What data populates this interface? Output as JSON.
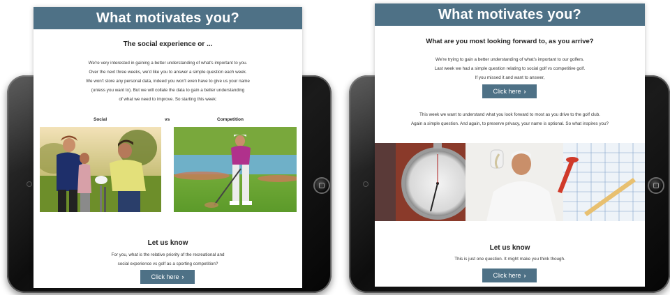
{
  "left_email": {
    "banner": "What motivates you?",
    "heading": "The social experience or ...",
    "intro_lines": [
      "We're very interested in gaining a better understanding of what's important to you.",
      "Over the next three weeks, we'd like you to answer a simple question each week.",
      "We won't store any personal data, indeed you won't even have to give us your name",
      "(unless you want to). But we will collate the data to gain a better understanding",
      "of what we need to improve. So starting this week:"
    ],
    "label_social": "Social",
    "label_vs": "vs",
    "label_competition": "Competition",
    "cta_heading": "Let us know",
    "question_lines": [
      "For you, what is the relative priority of the recreational and",
      "social experience vs golf as a sporting competition?"
    ],
    "button_label": "Click here"
  },
  "right_email": {
    "banner": "What motivates you?",
    "heading": "What are you most looking forward to, as you arrive?",
    "intro_lines": [
      "We're trying to gain a better understanding of what's important to our golfers.",
      "Last week we had a simple question relating to social golf vs competitive golf.",
      "If you missed it and want to answer,"
    ],
    "button_1_label": "Click here",
    "body_lines": [
      "This week we want to understand what you look forward to most as you drive to the golf club.",
      "Again a simple question. And again, to preserve privacy, your name is optional. So what inspires you?"
    ],
    "cta_heading": "Let us know",
    "cta_text": "This is just one question. It might make you think though.",
    "button_2_label": "Click here"
  },
  "colors": {
    "brand": "#4e7186",
    "button_text": "#ffffff",
    "tablet": "#111111"
  },
  "icons": {
    "button_chevron": "chevron-right-icon"
  }
}
